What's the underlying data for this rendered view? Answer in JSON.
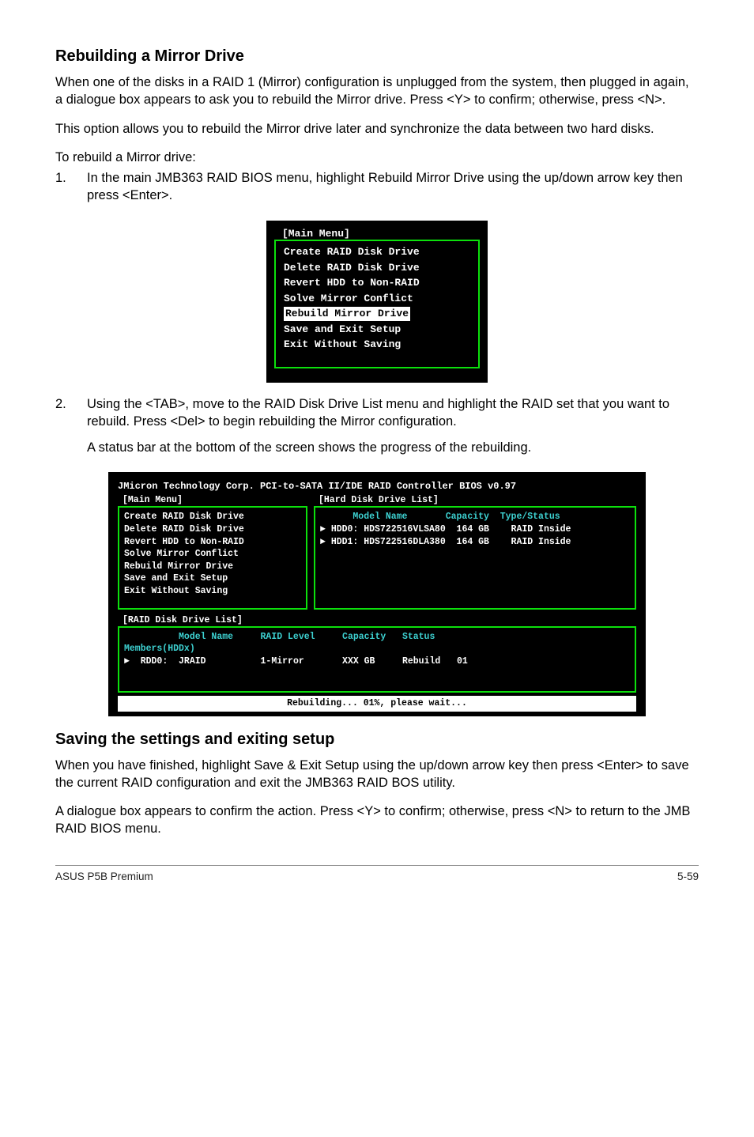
{
  "sections": {
    "rebuild": {
      "heading": "Rebuilding a Mirror Drive",
      "para1": "When one of the disks in a RAID 1 (Mirror) configuration is unplugged from the system, then plugged in again, a dialogue box appears to ask you to rebuild the Mirror drive. Press <Y> to confirm; otherwise, press <N>.",
      "para2": "This option allows you to rebuild the Mirror drive later and synchronize the data between two hard disks.",
      "para3": "To rebuild a Mirror drive:",
      "step1": "In the main JMB363 RAID BIOS menu, highlight Rebuild Mirror Drive using the up/down arrow key then press <Enter>.",
      "step2a": "Using the <TAB>, move to the RAID Disk Drive List menu and highlight the RAID set that you want to rebuild. Press <Del> to begin rebuilding the Mirror configuration.",
      "step2b": "A status bar at the bottom of the screen shows the progress of the rebuilding."
    },
    "saving": {
      "heading": "Saving the settings and exiting setup",
      "para1": "When you have finished, highlight Save & Exit Setup using the up/down arrow key then press <Enter> to save the current RAID configuration and exit the JMB363 RAID BOS utility.",
      "para2": "A dialogue box appears to confirm the action. Press <Y> to confirm; otherwise, press <N> to return to the JMB RAID BIOS menu."
    }
  },
  "bios_menu": {
    "title": "[Main Menu]",
    "items": [
      "Create RAID Disk Drive",
      "Delete RAID Disk Drive",
      "Revert HDD to Non-RAID",
      "Solve Mirror Conflict",
      "Rebuild Mirror Drive",
      "Save and Exit Setup",
      "Exit Without Saving"
    ],
    "highlighted_index": 4
  },
  "bios_large": {
    "header": "JMicron Technology Corp. PCI-to-SATA II/IDE RAID Controller BIOS v0.97",
    "main_menu_title": "[Main Menu]",
    "hdd_list_title": "[Hard Disk Drive List]",
    "main_menu_items": [
      "Create RAID Disk Drive",
      "Delete RAID Disk Drive",
      "Revert HDD to Non-RAID",
      "Solve Mirror Conflict",
      "Rebuild Mirror Drive",
      "Save and Exit Setup",
      "Exit Without Saving"
    ],
    "hdd_header": "      Model Name       Capacity  Type/Status",
    "hdd_rows": [
      "HDD0: HDS722516VLSA80  164 GB    RAID Inside",
      "HDD1: HDS722516DLA380  164 GB    RAID Inside"
    ],
    "raid_list_title": "[RAID Disk Drive List]",
    "raid_header": "          Model Name     RAID Level     Capacity   Status",
    "raid_sub": "Members(HDDx)",
    "raid_row": "  RDD0:  JRAID          1-Mirror       XXX GB     Rebuild   01",
    "status": "Rebuilding... 01%, please wait..."
  },
  "footer": {
    "left": "ASUS P5B Premium",
    "right": "5-59"
  }
}
